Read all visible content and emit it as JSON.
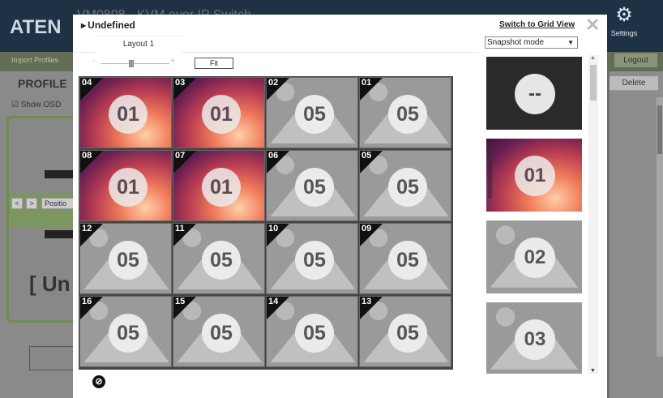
{
  "header": {
    "logo": "ATEN",
    "app_title": "VM0808 · KVM over IP Switch",
    "settings_label": "Settings",
    "settings_icon": "gear-icon"
  },
  "toolbar": {
    "import_profiles": "Import Profiles",
    "logout": "Logout",
    "delete": "Delete"
  },
  "left_panel": {
    "profile_heading": "PROFILE",
    "show_osd": "Show OSD",
    "prev": "<",
    "next": ">",
    "position": "Positio",
    "status": "[ Un"
  },
  "dialog": {
    "title": "Undefined",
    "switch_view": "Switch to Grid View",
    "close_icon": "close-icon",
    "mode": "Snapshot mode",
    "tab": "Layout 1",
    "fit": "Fit",
    "zoom_minus": "-",
    "zoom_plus": "+",
    "zoom_level": 0.45,
    "grid": [
      {
        "num": "04",
        "label": "01",
        "kind": "img"
      },
      {
        "num": "03",
        "label": "01",
        "kind": "img"
      },
      {
        "num": "02",
        "label": "05",
        "kind": "gray"
      },
      {
        "num": "01",
        "label": "05",
        "kind": "gray"
      },
      {
        "num": "08",
        "label": "01",
        "kind": "img"
      },
      {
        "num": "07",
        "label": "01",
        "kind": "img"
      },
      {
        "num": "06",
        "label": "05",
        "kind": "gray"
      },
      {
        "num": "05",
        "label": "05",
        "kind": "gray"
      },
      {
        "num": "12",
        "label": "05",
        "kind": "gray"
      },
      {
        "num": "11",
        "label": "05",
        "kind": "gray"
      },
      {
        "num": "10",
        "label": "05",
        "kind": "gray"
      },
      {
        "num": "09",
        "label": "05",
        "kind": "gray"
      },
      {
        "num": "16",
        "label": "05",
        "kind": "gray"
      },
      {
        "num": "15",
        "label": "05",
        "kind": "gray"
      },
      {
        "num": "14",
        "label": "05",
        "kind": "gray"
      },
      {
        "num": "13",
        "label": "05",
        "kind": "gray"
      }
    ],
    "thumbnails": [
      {
        "label": "--",
        "kind": "dark"
      },
      {
        "label": "01",
        "kind": "img"
      },
      {
        "label": "02",
        "kind": "gray"
      },
      {
        "label": "03",
        "kind": "gray"
      }
    ],
    "footer_icon": "no-entry-icon",
    "footer_glyph": "⊘"
  }
}
